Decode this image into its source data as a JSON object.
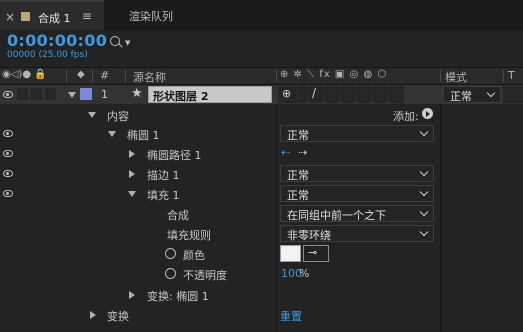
{
  "tabs": {
    "close_glyph": "×",
    "comp_tab_label": "合成 1",
    "menu_glyph": "≡",
    "render_queue_label": "渲染队列"
  },
  "time": {
    "timecode": "0:00:00:00",
    "frames_fps": "00000 (25.00 fps)"
  },
  "search": {
    "placeholder": ""
  },
  "header": {
    "hash": "#",
    "source_name": "源名称",
    "switch_icons": "⊕ ✲ ⟍ fx ▣ ◎ ◍ ⬡",
    "mode": "模式",
    "trk": "T"
  },
  "layer": {
    "index": "1",
    "name": "形状图层 2",
    "mode_value": "正常"
  },
  "rows": {
    "contents": "内容",
    "add_label": "添加:",
    "ellipse": "椭圆 1",
    "ellipse_mode": "正常",
    "ellipse_path": "椭圆路径 1",
    "stroke": "描边 1",
    "stroke_mode": "正常",
    "fill": "填充 1",
    "fill_mode": "正常",
    "composite": "合成",
    "composite_value": "在同组中前一个之下",
    "fill_rule": "填充规则",
    "fill_rule_value": "非零环绕",
    "color": "颜色",
    "opacity": "不透明度",
    "opacity_value": "100",
    "opacity_unit": "%",
    "transform_ellipse": "变换: 椭圆 1",
    "transform": "变换",
    "reset": "重置"
  },
  "colors": {
    "accent": "#3c9be0",
    "layer_label": "#7e88d9",
    "fill_color": "#f2f2f6"
  }
}
